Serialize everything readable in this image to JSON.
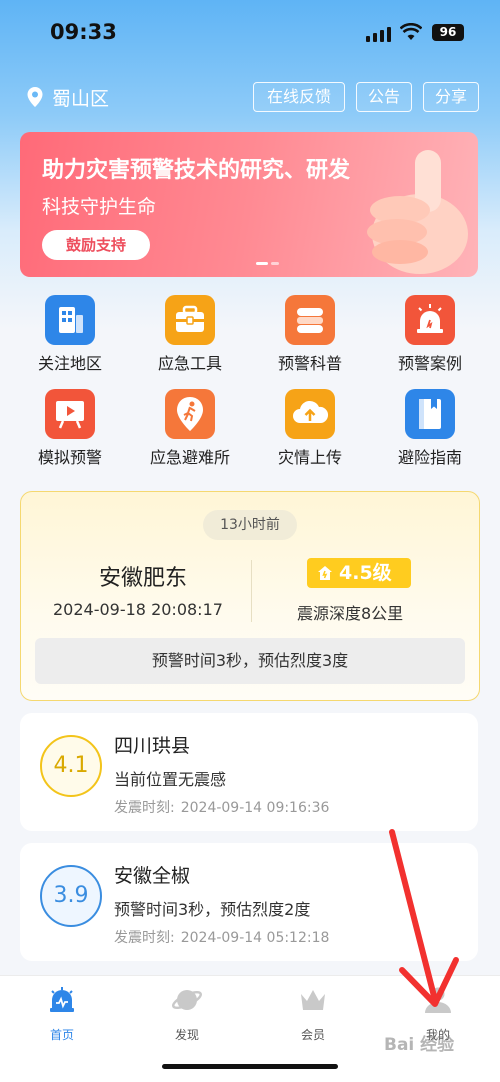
{
  "status": {
    "time": "09:33",
    "battery": "96"
  },
  "header": {
    "location": "蜀山区",
    "buttons": [
      "在线反馈",
      "公告",
      "分享"
    ]
  },
  "banner": {
    "title": "助力灾害预警技术的研究、研发",
    "subtitle": "科技守护生命",
    "button": "鼓励支持"
  },
  "grid": [
    {
      "label": "关注地区",
      "icon": "building-icon",
      "color": "#2e86e8"
    },
    {
      "label": "应急工具",
      "icon": "toolbox-icon",
      "color": "#f6a317"
    },
    {
      "label": "预警科普",
      "icon": "book-stack-icon",
      "color": "#f5773a"
    },
    {
      "label": "预警案例",
      "icon": "alarm-light-icon",
      "color": "#f2553a"
    },
    {
      "label": "模拟预警",
      "icon": "presentation-icon",
      "color": "#f2553a"
    },
    {
      "label": "应急避难所",
      "icon": "running-person-pin-icon",
      "color": "#f5773a"
    },
    {
      "label": "灾情上传",
      "icon": "cloud-upload-icon",
      "color": "#f6a317"
    },
    {
      "label": "避险指南",
      "icon": "guide-book-icon",
      "color": "#2e86e8"
    }
  ],
  "featured": {
    "ago": "13小时前",
    "place": "安徽肥东",
    "datetime": "2024-09-18 20:08:17",
    "magnitude": "4.5级",
    "depth": "震源深度8公里",
    "warning": "预警时间3秒，预估烈度3度"
  },
  "list": [
    {
      "magnitude": "4.1",
      "color": "#f3c41a",
      "place": "四川珙县",
      "desc": "当前位置无震感",
      "time_label": "发震时刻:",
      "time": "2024-09-14 09:16:36"
    },
    {
      "magnitude": "3.9",
      "color": "#3a8de0",
      "place": "安徽全椒",
      "desc": "预警时间3秒，预估烈度2度",
      "time_label": "发震时刻:",
      "time": "2024-09-14 05:12:18"
    }
  ],
  "tabs": [
    {
      "label": "首页",
      "icon": "alarm-home-icon"
    },
    {
      "label": "发现",
      "icon": "planet-icon"
    },
    {
      "label": "会员",
      "icon": "crown-icon"
    },
    {
      "label": "我的",
      "icon": "person-icon"
    }
  ],
  "watermark": "Bai 经验"
}
